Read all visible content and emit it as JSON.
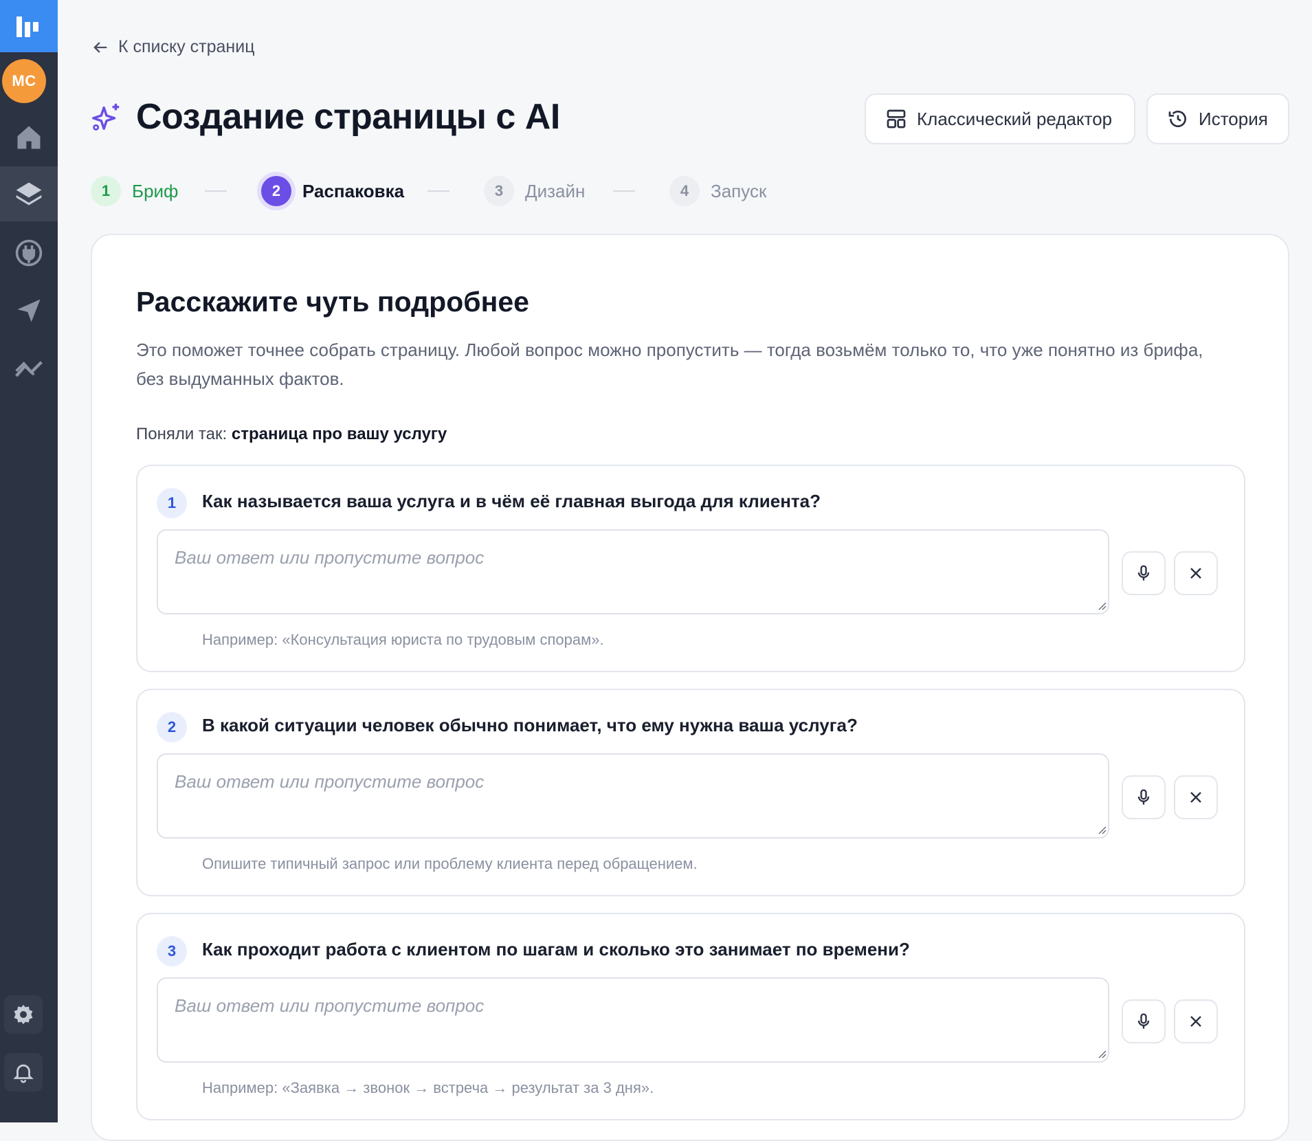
{
  "sidebar": {
    "avatar_initials": "MC",
    "nav": [
      "logo-icon",
      "home-icon",
      "layers-icon",
      "plug-icon",
      "send-icon",
      "analytics-icon",
      "gear-icon",
      "bell-icon"
    ]
  },
  "header": {
    "back_label": "К списку страниц",
    "title": "Создание страницы с AI",
    "classic_editor_label": "Классический редактор",
    "history_label": "История"
  },
  "stepper": {
    "steps": [
      {
        "num": "1",
        "label": "Бриф",
        "state": "done"
      },
      {
        "num": "2",
        "label": "Распаковка",
        "state": "active"
      },
      {
        "num": "3",
        "label": "Дизайн",
        "state": "pending"
      },
      {
        "num": "4",
        "label": "Запуск",
        "state": "pending"
      }
    ]
  },
  "card": {
    "title": "Расскажите чуть подробнее",
    "subtitle": "Это поможет точнее собрать страницу. Любой вопрос можно пропустить — тогда возьмём только то, что уже понятно из брифа, без выдуманных фактов.",
    "understood_prefix": "Поняли так:",
    "understood_value": "страница про вашу услугу"
  },
  "questions": [
    {
      "num": "1",
      "text": "Как называется ваша услуга и в чём её главная выгода для клиента?",
      "placeholder": "Ваш ответ или пропустите вопрос",
      "value": "",
      "hint": "Например: «Консультация юриста по трудовым спорам»."
    },
    {
      "num": "2",
      "text": "В какой ситуации человек обычно понимает, что ему нужна ваша услуга?",
      "placeholder": "Ваш ответ или пропустите вопрос",
      "value": "",
      "hint": "Опишите типичный запрос или проблему клиента перед обращением."
    },
    {
      "num": "3",
      "text": "Как проходит работа с клиентом по шагам и сколько это занимает по времени?",
      "placeholder": "Ваш ответ или пропустите вопрос",
      "value": "",
      "hint": "Например: «Заявка → звонок → встреча → результат за 3 дня»."
    }
  ],
  "colors": {
    "sidebar_bg": "#2c3342",
    "logo_bg": "#3b8cf2",
    "avatar_bg": "#f59a3b",
    "accent_purple": "#6b4ee6",
    "done_green": "#1e9a4a",
    "question_num_blue": "#2f56d9"
  }
}
